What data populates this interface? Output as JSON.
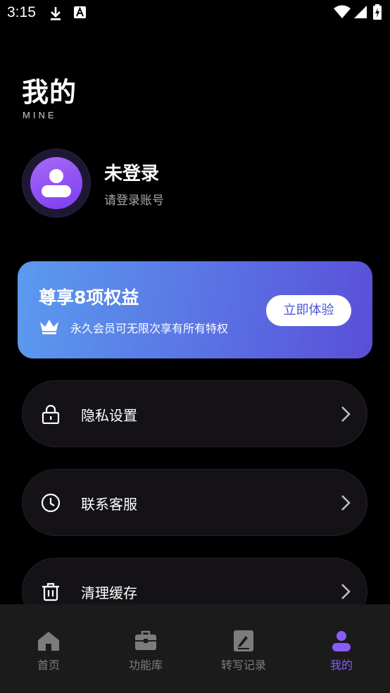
{
  "status_bar": {
    "time": "3:15"
  },
  "header": {
    "title": "我的",
    "subtitle": "MINE"
  },
  "profile": {
    "name": "未登录",
    "hint": "请登录账号"
  },
  "vip_card": {
    "title": "尊享8项权益",
    "description": "永久会员可无限次享有所有特权",
    "button_label": "立即体验"
  },
  "menu": [
    {
      "label": "隐私设置",
      "icon": "lock-icon"
    },
    {
      "label": "联系客服",
      "icon": "clock-icon"
    },
    {
      "label": "清理缓存",
      "icon": "trash-icon"
    }
  ],
  "tabs": [
    {
      "label": "首页",
      "icon": "home-icon",
      "active": false
    },
    {
      "label": "功能库",
      "icon": "briefcase-icon",
      "active": false
    },
    {
      "label": "转写记录",
      "icon": "document-icon",
      "active": false
    },
    {
      "label": "我的",
      "icon": "person-icon",
      "active": true
    }
  ],
  "colors": {
    "accent": "#8a5cf6",
    "vip_gradient_start": "#5b9bef",
    "vip_gradient_end": "#5a4fd8"
  }
}
